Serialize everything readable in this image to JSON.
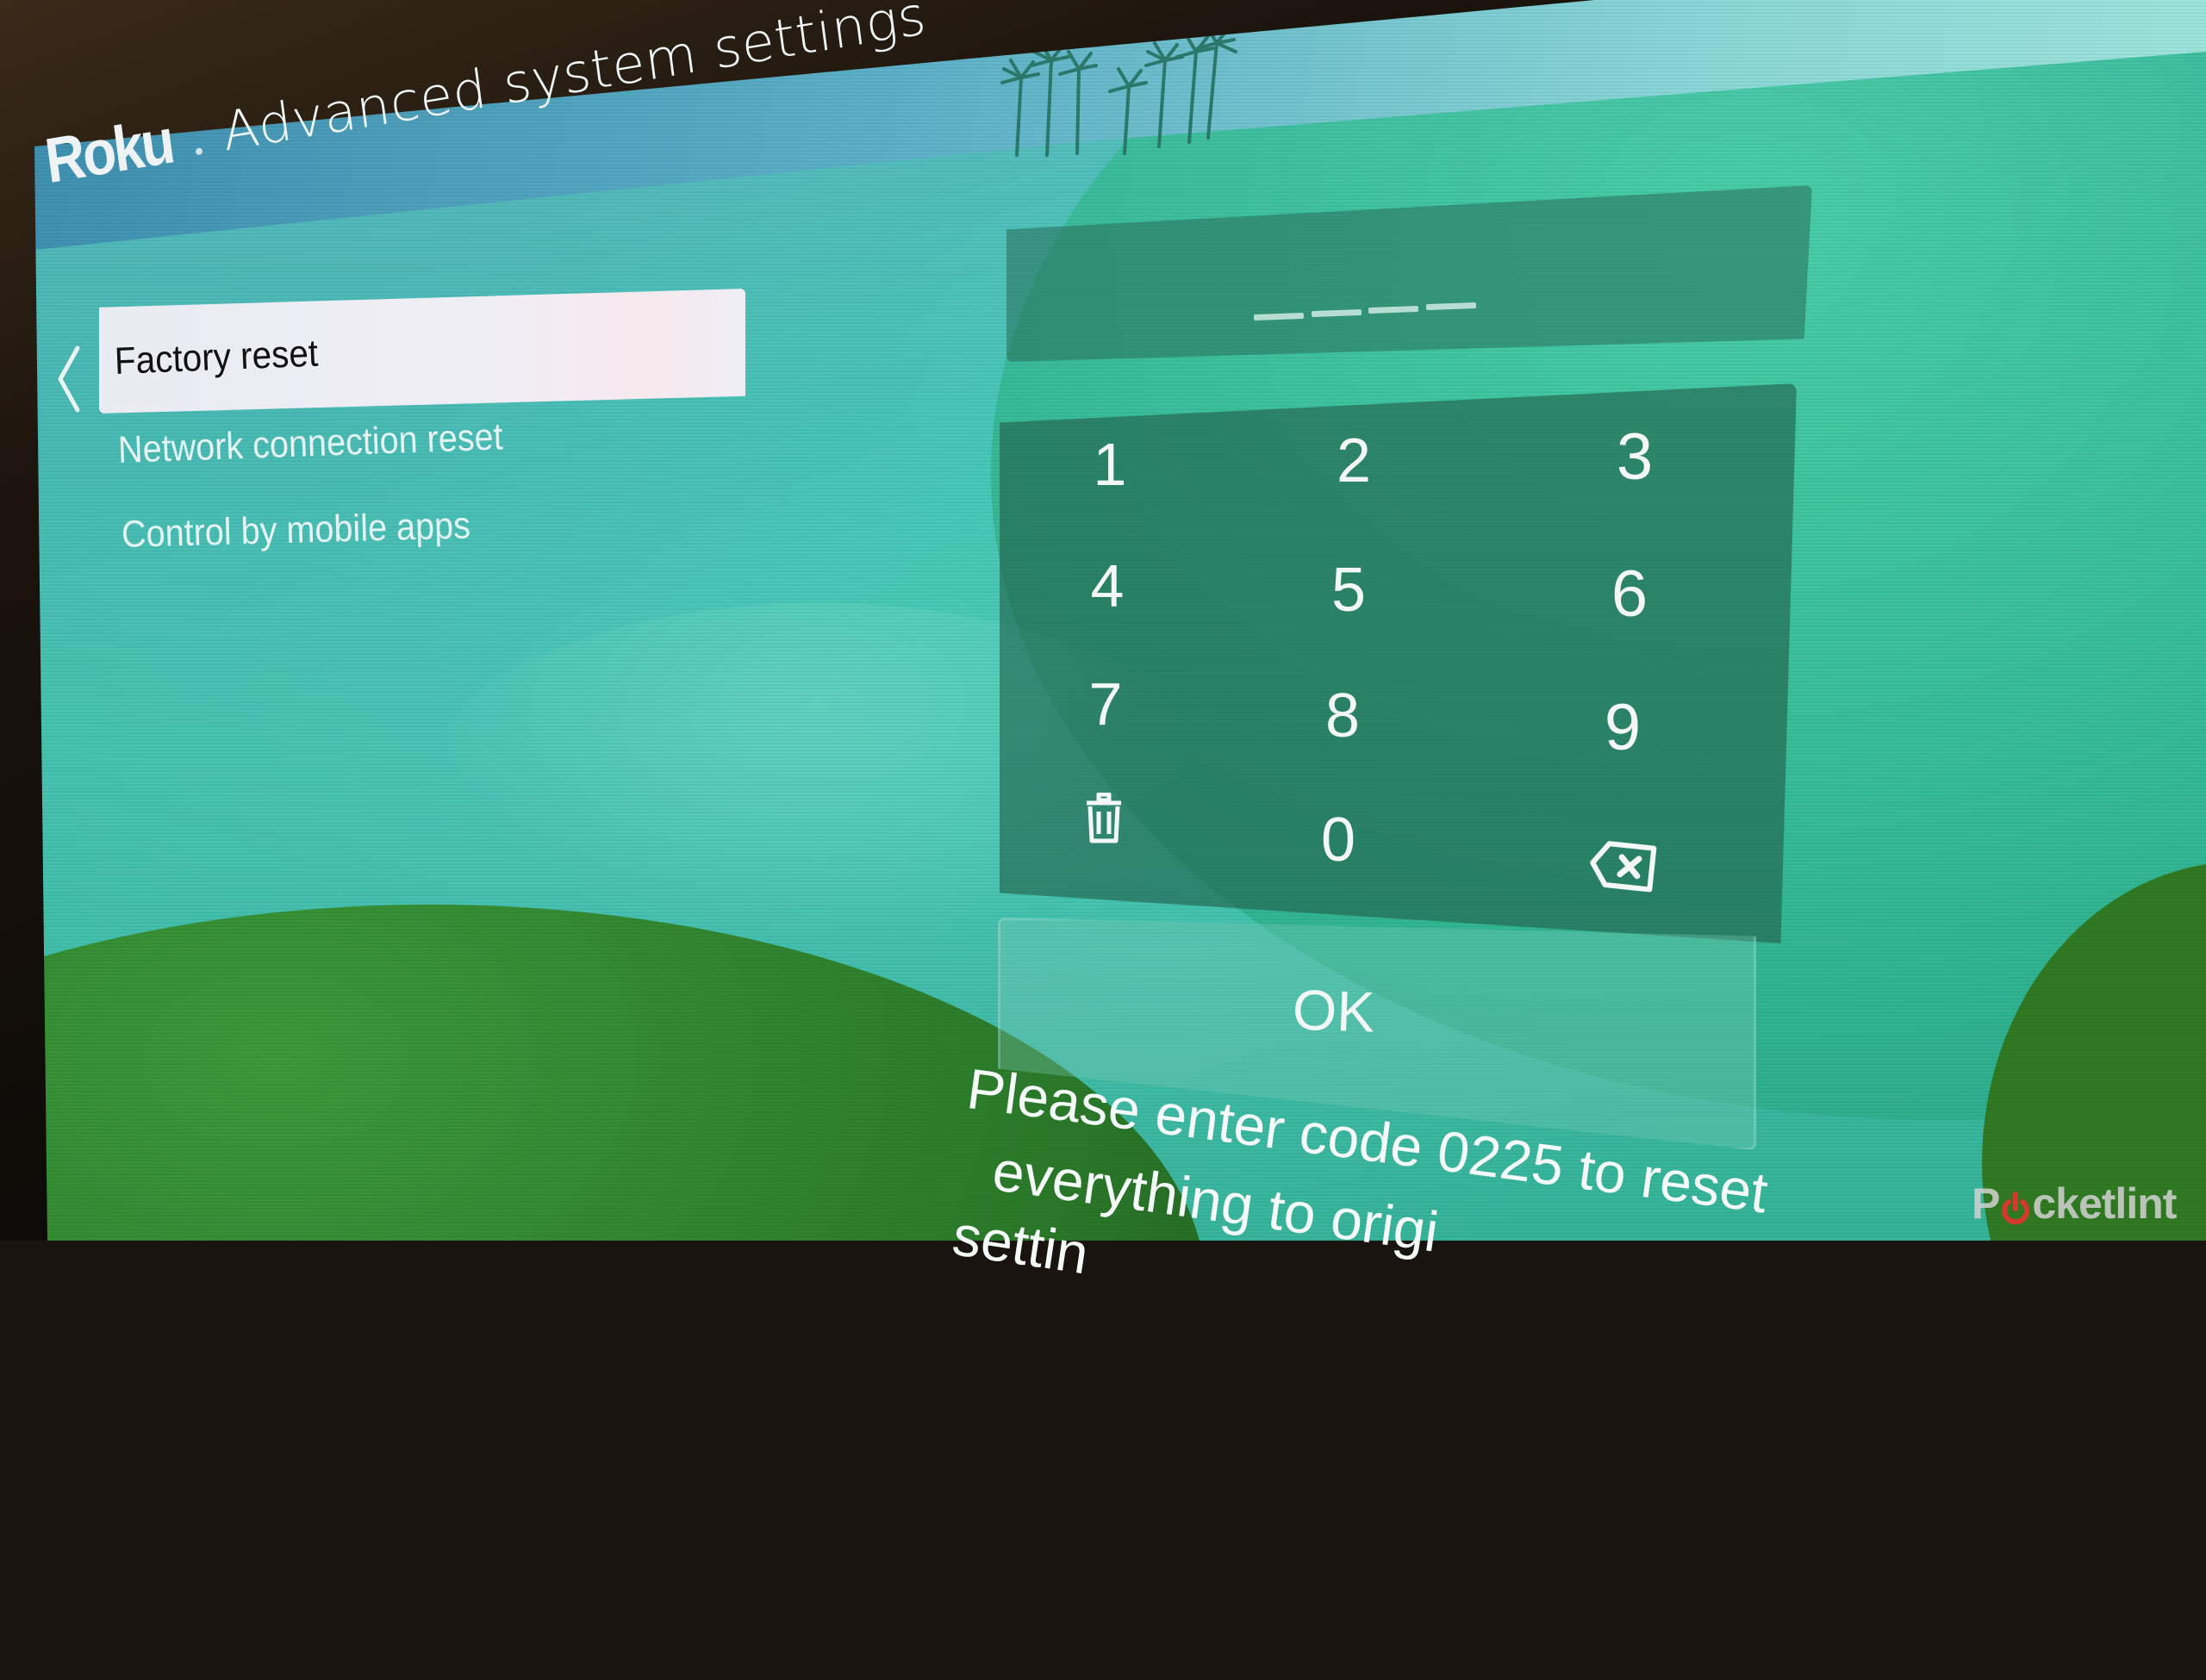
{
  "header": {
    "brand": "Roku",
    "separator": "·",
    "title": "Advanced system settings"
  },
  "menu": {
    "back_icon": "chevron-left-icon",
    "items": [
      {
        "label": "Factory reset",
        "selected": true
      },
      {
        "label": "Network connection reset",
        "selected": false
      },
      {
        "label": "Control by mobile apps",
        "selected": false
      }
    ]
  },
  "code_input": {
    "value": "",
    "slots": 4,
    "placeholder_glyph": "_"
  },
  "keypad": {
    "keys": [
      "1",
      "2",
      "3",
      "4",
      "5",
      "6",
      "7",
      "8",
      "9",
      "0"
    ],
    "clear_icon": "trash-icon",
    "backspace_icon": "backspace-icon"
  },
  "ok_button": {
    "label": "OK"
  },
  "message": {
    "lines": [
      "Please enter code 0225 to reset",
      "everything to origi",
      "settin"
    ],
    "code": "0225"
  },
  "watermark": {
    "text_before": "P",
    "text_after": "cketlint",
    "accent": "#d33a2c"
  },
  "colors": {
    "background_teal": "#3fc2a8",
    "header_band": "#5cb0c8",
    "highlight": "#eceef3",
    "keypad_panel": "#225f48",
    "text_light": "#f2f8f6"
  }
}
